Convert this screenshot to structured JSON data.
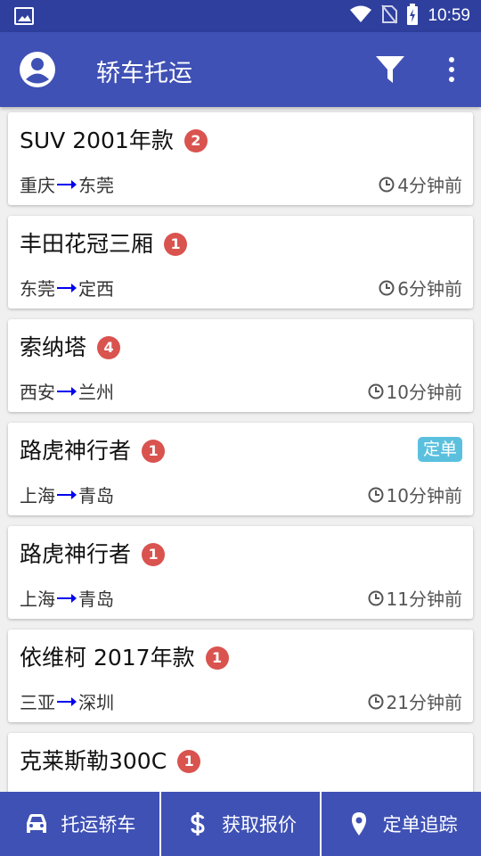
{
  "status_bar": {
    "time": "10:59",
    "icons": [
      "image-icon",
      "wifi-icon",
      "no-sim-icon",
      "battery-charging-icon"
    ]
  },
  "app_bar": {
    "title": "轿车托运",
    "icons": [
      "account-circle-icon",
      "filter-icon",
      "more-vert-icon"
    ]
  },
  "orders": [
    {
      "name": "SUV 2001年款",
      "count": "2",
      "from": "重庆",
      "to": "东莞",
      "time": "4分钟前",
      "tag": ""
    },
    {
      "name": "丰田花冠三厢",
      "count": "1",
      "from": "东莞",
      "to": "定西",
      "time": "6分钟前",
      "tag": ""
    },
    {
      "name": "索纳塔",
      "count": "4",
      "from": "西安",
      "to": "兰州",
      "time": "10分钟前",
      "tag": ""
    },
    {
      "name": "路虎神行者",
      "count": "1",
      "from": "上海",
      "to": "青岛",
      "time": "10分钟前",
      "tag": "定单"
    },
    {
      "name": "路虎神行者",
      "count": "1",
      "from": "上海",
      "to": "青岛",
      "time": "11分钟前",
      "tag": ""
    },
    {
      "name": "依维柯 2017年款",
      "count": "1",
      "from": "三亚",
      "to": "深圳",
      "time": "21分钟前",
      "tag": ""
    },
    {
      "name": "克莱斯勒300C",
      "count": "1",
      "from": "",
      "to": "",
      "time": "",
      "tag": ""
    }
  ],
  "bottom_nav": {
    "ship": "托运轿车",
    "quote": "获取报价",
    "track": "定单追踪"
  },
  "colors": {
    "app_bar": "#3f51b5",
    "status_bar": "#2e3f9e",
    "badge": "#d9534f",
    "tag": "#5bc0de",
    "route_arrow": "#0000ee",
    "background": "#f0f0f0"
  }
}
